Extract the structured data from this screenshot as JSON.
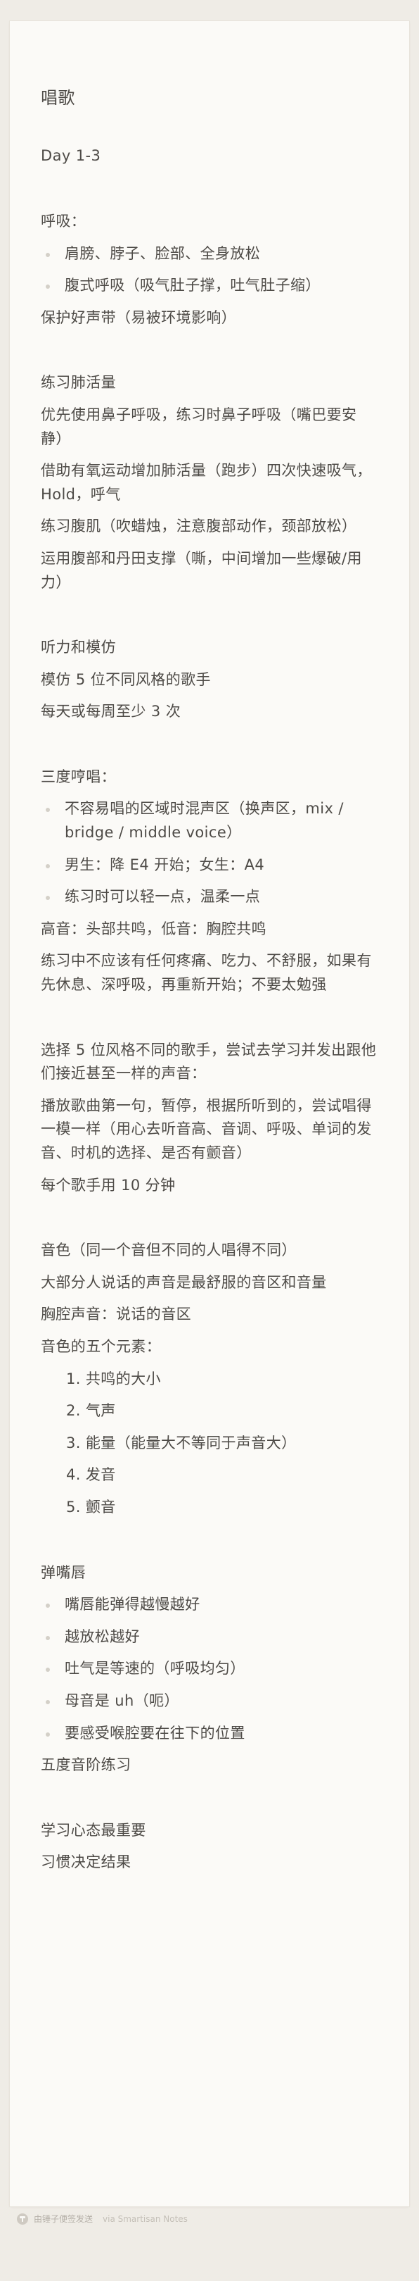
{
  "note": {
    "title": "唱歌",
    "day": "Day 1-3",
    "breathing": {
      "head": "呼吸：",
      "bullets": [
        "肩膀、脖子、脸部、全身放松",
        "腹式呼吸（吸气肚子撑，吐气肚子缩）"
      ],
      "after": "保护好声带（易被环境影响）"
    },
    "lung": {
      "head": "练习肺活量",
      "lines": [
        "优先使用鼻子呼吸，练习时鼻子呼吸（嘴巴要安静）",
        "借助有氧运动增加肺活量（跑步）四次快速吸气，Hold，呼气",
        "练习腹肌（吹蜡烛，注意腹部动作，颈部放松）",
        "运用腹部和丹田支撑（嘶，中间增加一些爆破/用力）"
      ]
    },
    "listening": {
      "head": "听力和模仿",
      "lines": [
        "模仿 5 位不同风格的歌手",
        "每天或每周至少 3 次"
      ]
    },
    "thirds": {
      "head": "三度哼唱：",
      "bullets": [
        "不容易唱的区域时混声区（换声区，mix / bridge / middle voice）",
        "男生：降 E4 开始；女生：A4",
        "练习时可以轻一点，温柔一点"
      ],
      "lines": [
        "高音：头部共鸣，低音：胸腔共鸣",
        "练习中不应该有任何疼痛、吃力、不舒服，如果有先休息、深呼吸，再重新开始；不要太勉强"
      ]
    },
    "imitate": {
      "lines": [
        "选择 5 位风格不同的歌手，尝试去学习并发出跟他们接近甚至一样的声音：",
        "播放歌曲第一句，暂停，根据所听到的，尝试唱得一模一样（用心去听音高、音调、呼吸、单词的发音、时机的选择、是否有颤音）",
        "每个歌手用 10 分钟"
      ]
    },
    "timbre": {
      "lines": [
        "音色（同一个音但不同的人唱得不同）",
        "大部分人说话的声音是最舒服的音区和音量",
        "胸腔声音：说话的音区",
        "音色的五个元素："
      ],
      "elements": [
        "1. 共鸣的大小",
        "2. 气声",
        "3. 能量（能量大不等同于声音大）",
        "4. 发音",
        "5. 颤音"
      ]
    },
    "lips": {
      "head": "弹嘴唇",
      "bullets": [
        "嘴唇能弹得越慢越好",
        "越放松越好",
        "吐气是等速的（呼吸均匀）",
        "母音是 uh（呃）",
        "要感受喉腔要在往下的位置"
      ],
      "after": "五度音阶练习"
    },
    "mindset": {
      "lines": [
        "学习心态最重要",
        "习惯决定结果"
      ]
    }
  },
  "footer": {
    "brand": "由锤子便签发送",
    "via": "via Smartisan Notes",
    "logo_icon": "hammer-logo-icon"
  }
}
